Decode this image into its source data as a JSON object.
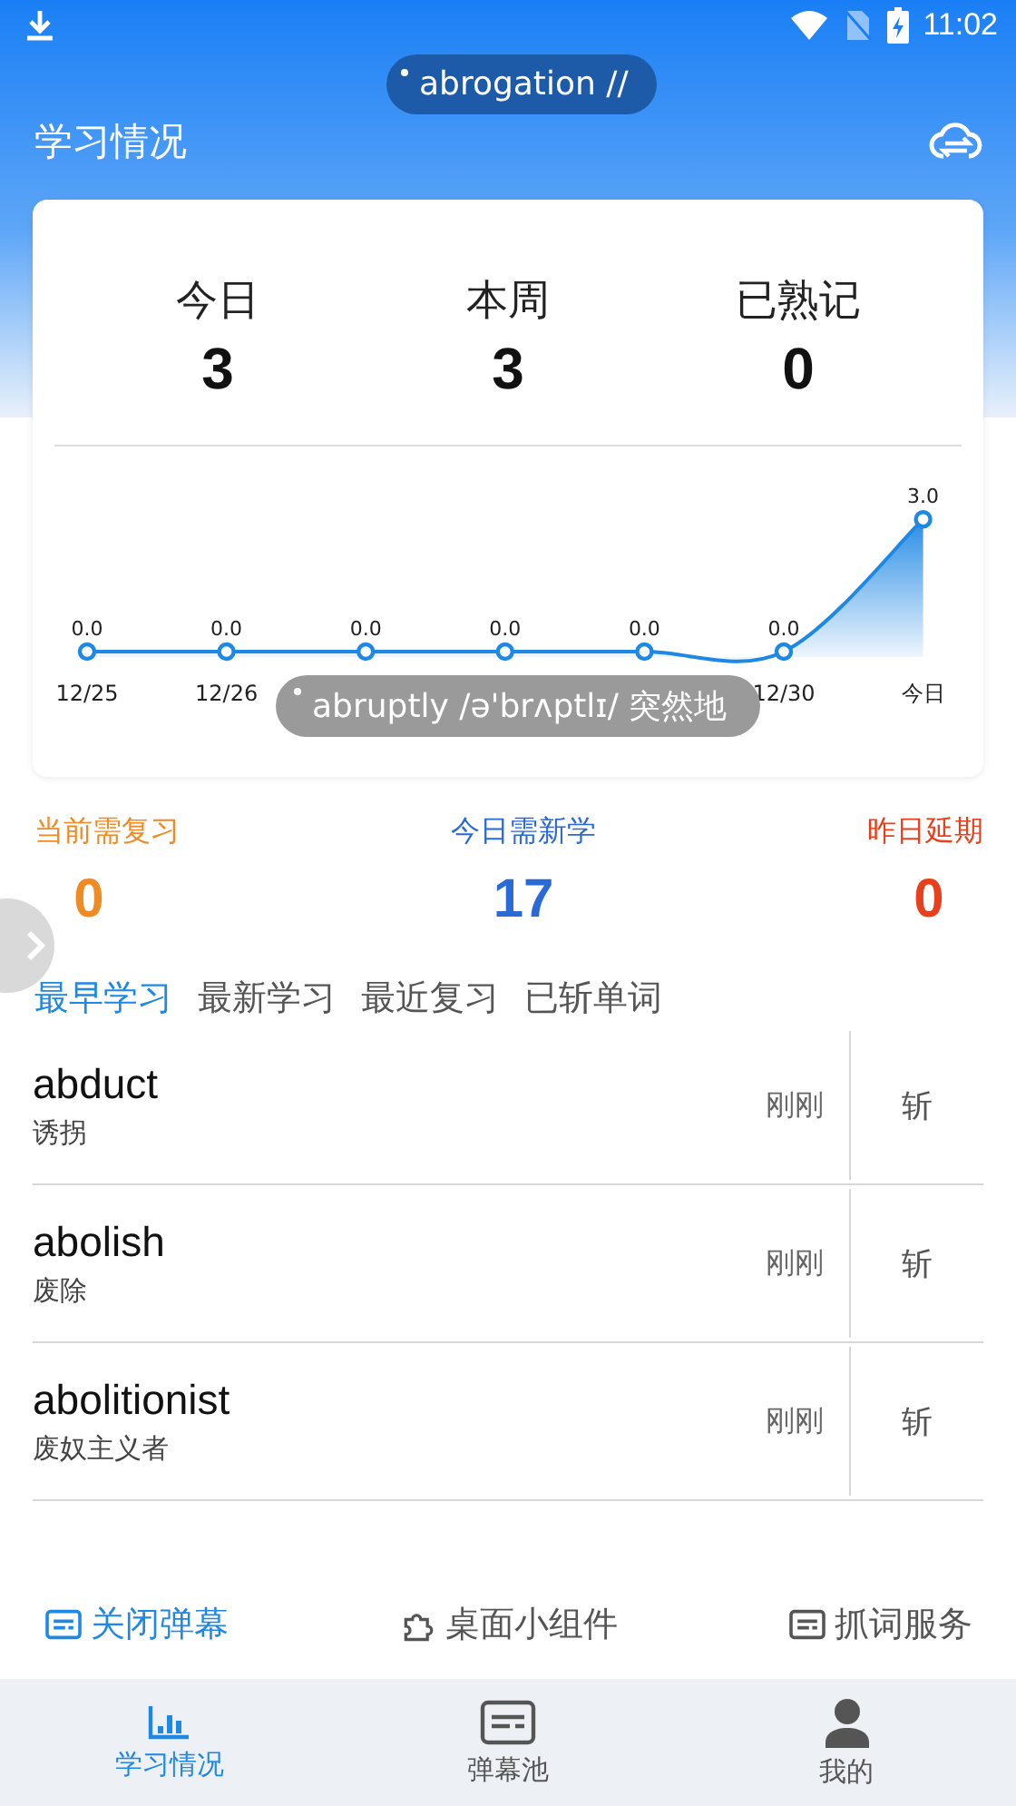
{
  "status_bar": {
    "time": "11:02"
  },
  "header": {
    "title": "学习情况"
  },
  "floating_bubbles": [
    {
      "text": "abrogation //"
    },
    {
      "text": "abruptly /ə'brʌptlɪ/ 突然地"
    }
  ],
  "summary": [
    {
      "label": "今日",
      "value": "3"
    },
    {
      "label": "本周",
      "value": "3"
    },
    {
      "label": "已熟记",
      "value": "0"
    }
  ],
  "chart_data": {
    "type": "line",
    "categories": [
      "12/25",
      "12/26",
      null,
      null,
      null,
      "12/30",
      "今日"
    ],
    "series": [
      {
        "color": "#1e88e5",
        "marker": true,
        "values": [
          0,
          0,
          0,
          0,
          0,
          0,
          3
        ],
        "value_labels": [
          "0.0",
          "0.0",
          "0.0",
          "0.0",
          "0.0",
          "0.0",
          "3.0"
        ]
      }
    ]
  },
  "review_stats": [
    {
      "label": "当前需复习",
      "value": "0",
      "color": "#f08a24"
    },
    {
      "label": "今日需新学",
      "value": "17",
      "color": "#2a6ad6"
    },
    {
      "label": "昨日延期",
      "value": "0",
      "color": "#e8401c"
    }
  ],
  "tabs": [
    {
      "label": "最早学习",
      "selected": true
    },
    {
      "label": "最新学习",
      "selected": false
    },
    {
      "label": "最近复习",
      "selected": false
    },
    {
      "label": "已斩单词",
      "selected": false
    }
  ],
  "words": [
    {
      "word": "abduct",
      "meaning": "诱拐",
      "time": "刚刚",
      "action": "斩"
    },
    {
      "word": "abolish",
      "meaning": "废除",
      "time": "刚刚",
      "action": "斩"
    },
    {
      "word": "abolitionist",
      "meaning": "废奴主义者",
      "time": "刚刚",
      "action": "斩"
    }
  ],
  "actions": [
    {
      "label": "关闭弹幕",
      "kind": "subtitle",
      "on": true
    },
    {
      "label": "桌面小组件",
      "kind": "puzzle",
      "on": false
    },
    {
      "label": "抓词服务",
      "kind": "subtitle",
      "on": false
    }
  ],
  "bottom_nav": [
    {
      "label": "学习情况",
      "kind": "chart",
      "selected": true
    },
    {
      "label": "弹幕池",
      "kind": "subtitle",
      "selected": false
    },
    {
      "label": "我的",
      "kind": "person",
      "selected": false
    }
  ]
}
